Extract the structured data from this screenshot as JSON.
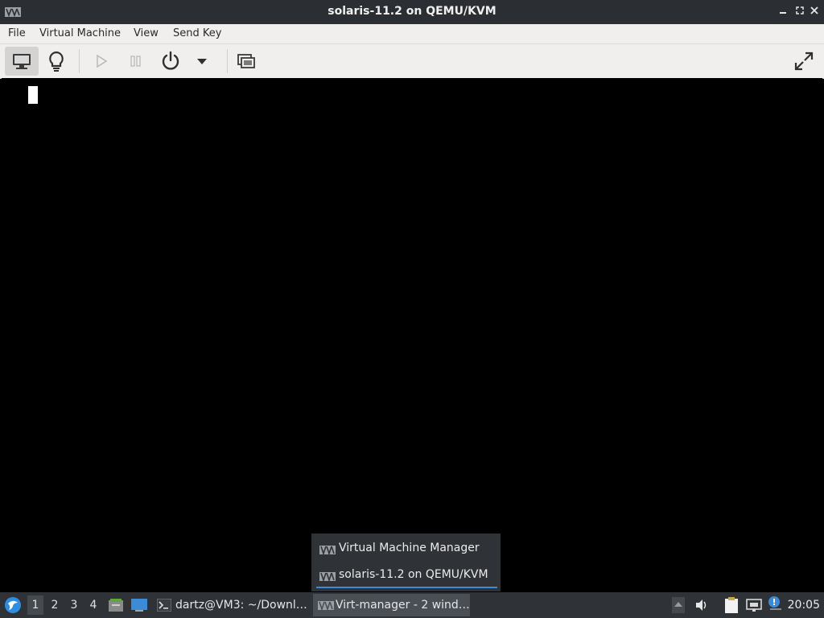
{
  "window": {
    "title": "solaris-11.2 on QEMU/KVM",
    "minimize_glyph": "▁",
    "maximize_glyph": "⤡",
    "close_glyph": "✕"
  },
  "menu": {
    "file": "File",
    "virtual_machine": "Virtual Machine",
    "view": "View",
    "send_key": "Send Key"
  },
  "toolbar": {
    "buttons": [
      "console-icon",
      "lightbulb-icon",
      "play-icon",
      "pause-icon",
      "power-icon",
      "dropdown-icon",
      "snapshot-icon",
      "fullscreen-icon"
    ]
  },
  "popup": {
    "items": [
      "Virtual Machine Manager",
      "solaris-11.2 on QEMU/KVM"
    ]
  },
  "taskbar": {
    "desktops": [
      "1",
      "2",
      "3",
      "4"
    ],
    "tasks": [
      "dartz@VM3: ~/Downl…",
      "Virt-manager - 2 wind…"
    ],
    "clock": "20:05"
  },
  "colors": {
    "titlebar": "#2b2e33",
    "taskbar": "#2f3237",
    "accent": "#3d8bd6",
    "toolbar": "#f0efee"
  }
}
